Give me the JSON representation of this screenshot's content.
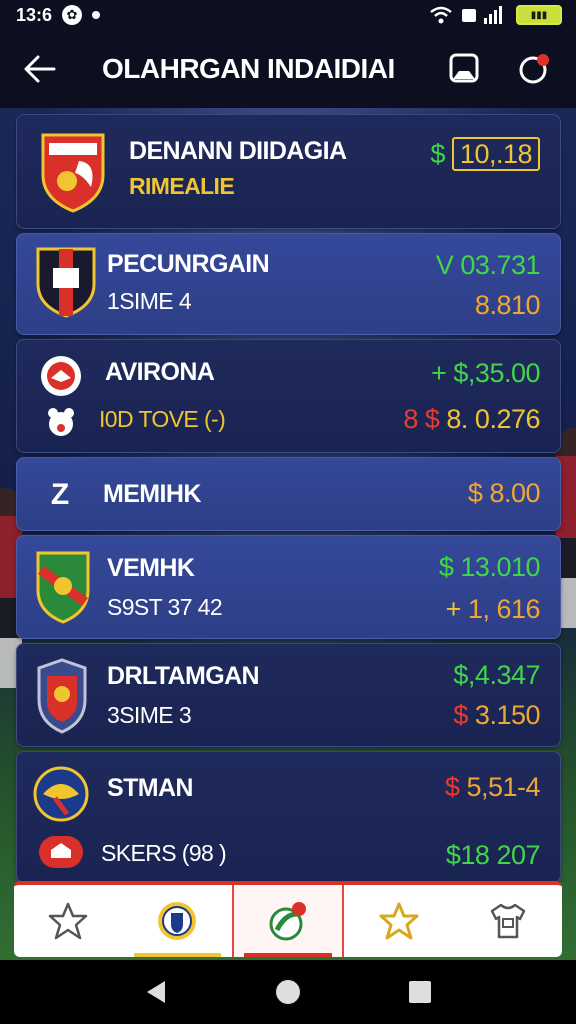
{
  "status_bar": {
    "time": "13:6"
  },
  "app_bar": {
    "title": "OLAHRGAN INDAIDIAI"
  },
  "rows": [
    {
      "name": "DENANN DIIDAGIA",
      "sub": "RIMEALIE",
      "value": "10,.18",
      "currency": "$"
    },
    {
      "name": "PECUNRGAIN",
      "sub": "1SIME 4",
      "value_top": "03.731",
      "value_bottom": "8.810",
      "top_prefix": "V"
    },
    {
      "name": "AVIRONA",
      "sub": "I0D TOVE  (-)",
      "value_top": "$,35.00",
      "top_prefix": "+",
      "value_bottom": "8. 0.276",
      "bottom_prefix": "8  $"
    },
    {
      "name": "MEMIHK",
      "value": "$ 8.00"
    },
    {
      "name": "VEMHK",
      "sub": "S9ST 37 42",
      "value_top": "13.010",
      "top_prefix": "$",
      "value_bottom": "1, 616",
      "bottom_prefix": "+"
    },
    {
      "name": "DRLTAMGAN",
      "sub": "3SIME 3",
      "value_top": "$,4.347",
      "value_bottom": "3.150",
      "bottom_prefix": "$"
    },
    {
      "name": "STMAN",
      "sub": "SKERS  (98 )",
      "value_top": "5,51-4",
      "top_prefix": "$",
      "value_bottom": "$18 207"
    }
  ],
  "colors": {
    "accent_yellow": "#f0c530",
    "positive_green": "#3fd64a",
    "negative_red": "#ea3b2f",
    "row_blue": "#2b3a78"
  },
  "icons": {
    "back": "arrow-left-icon",
    "save": "bookmark-icon",
    "notifications": "notification-icon",
    "tabs": [
      "star-outline-icon",
      "club-crest-icon",
      "ball-icon",
      "star-gold-icon",
      "jersey-icon"
    ],
    "nav": [
      "nav-back-icon",
      "nav-home-icon",
      "nav-recents-icon"
    ]
  }
}
